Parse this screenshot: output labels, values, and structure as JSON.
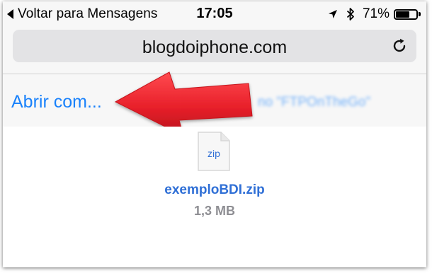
{
  "status_bar": {
    "back_label": "Voltar para Mensagens",
    "time": "17:05",
    "battery_percent": "71%",
    "battery_level": 0.71,
    "icons": [
      "back-arrow-icon",
      "location-icon",
      "bluetooth-icon",
      "battery-icon"
    ]
  },
  "browser": {
    "url": "blogdoiphone.com",
    "reload_icon": "reload-icon"
  },
  "action_bar": {
    "open_with_label": "Abrir com...",
    "blurred_label": "no \"FTPOnTheGo\""
  },
  "annotation": {
    "arrow_color": "#e8202a",
    "arrow_icon": "red-arrow-pointer"
  },
  "file": {
    "extension": "zip",
    "name": "exemploBDI.zip",
    "size": "1,3 MB"
  },
  "colors": {
    "link_blue": "#1a82fb",
    "file_blue": "#2f6fd6",
    "secondary_gray": "#8e8e93"
  }
}
